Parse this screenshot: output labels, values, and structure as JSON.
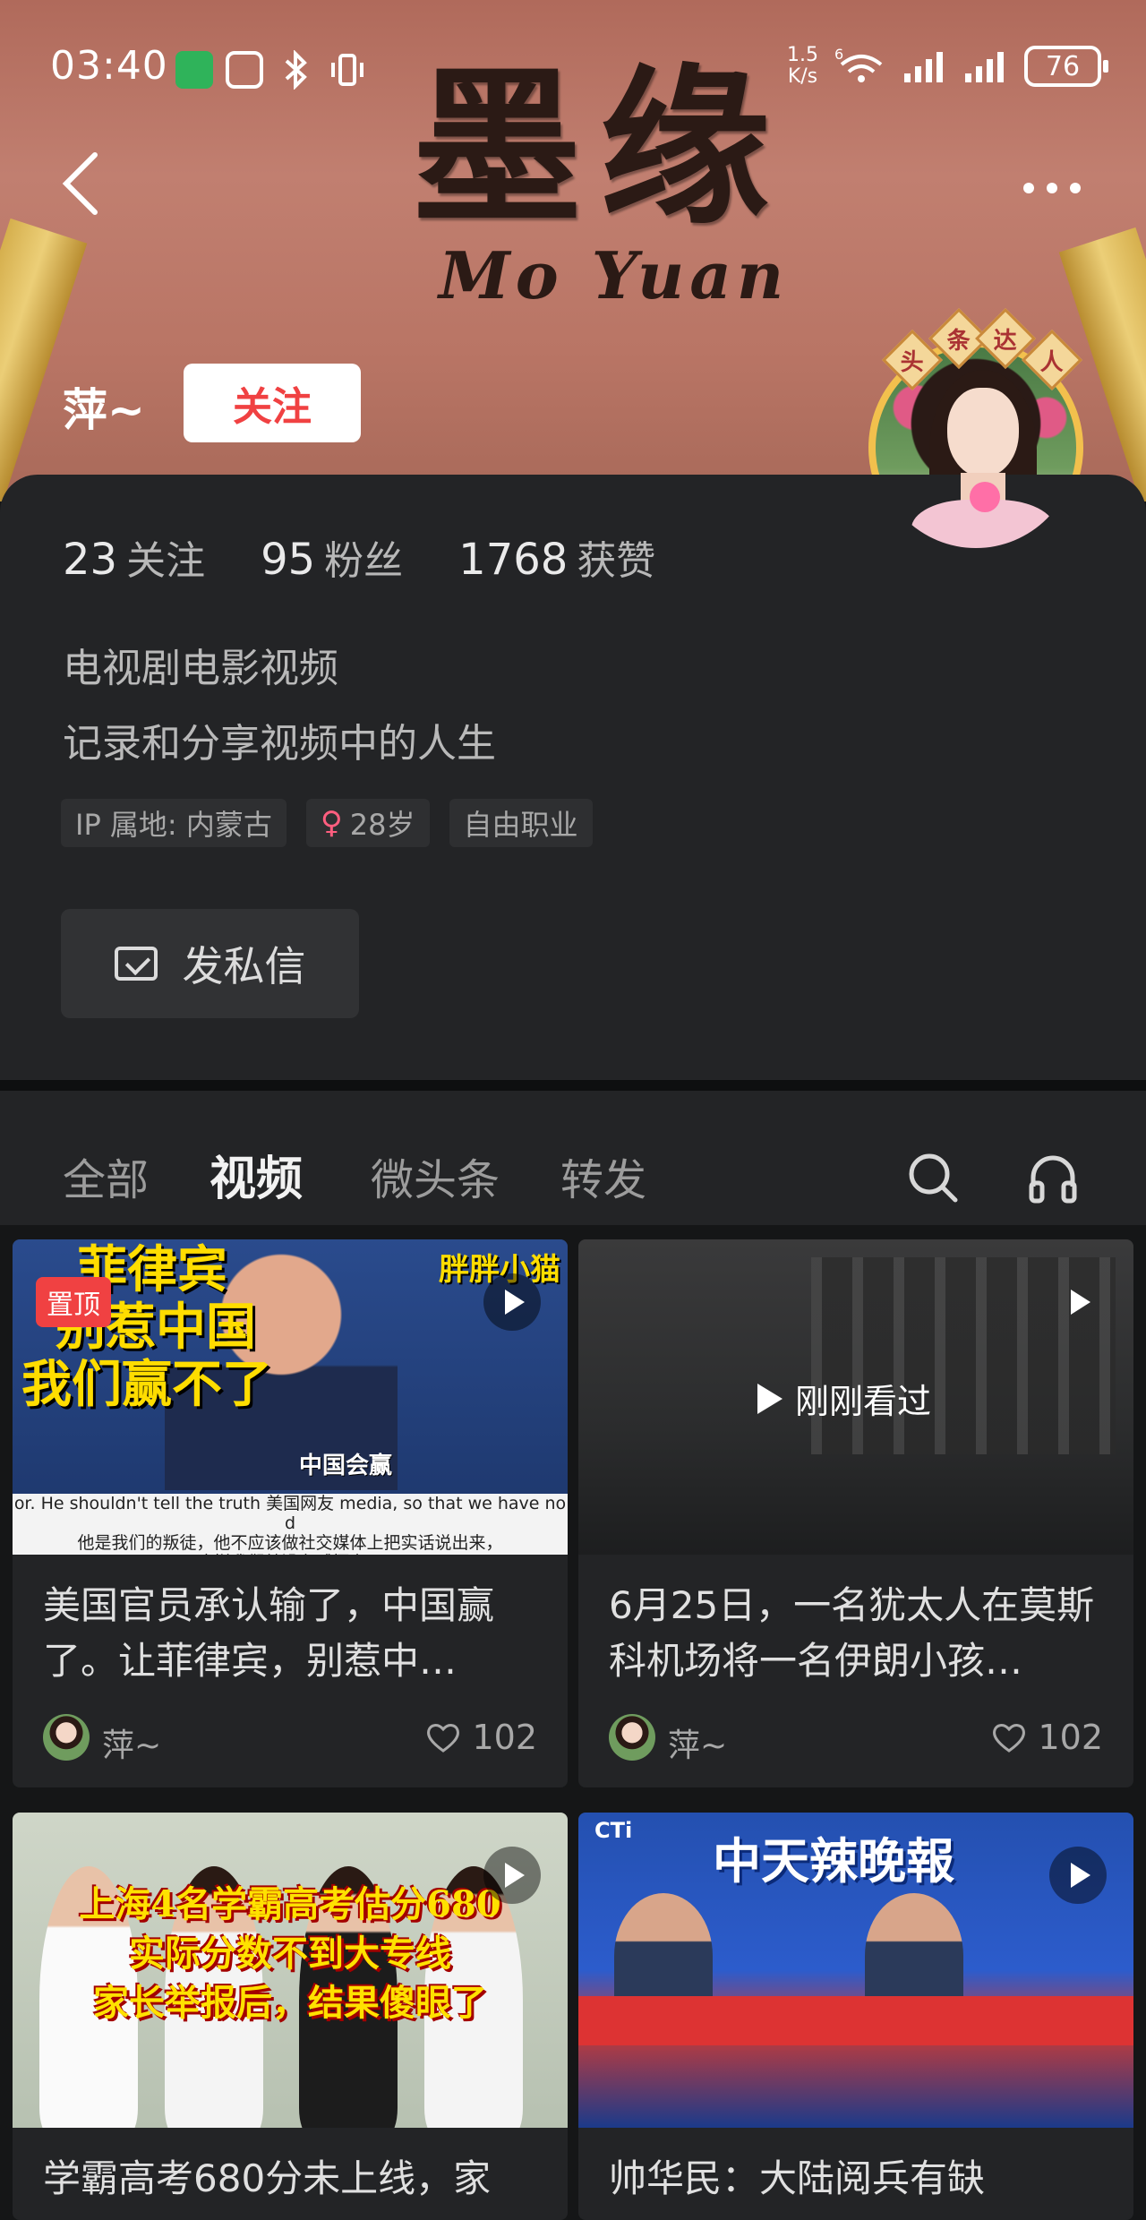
{
  "status_bar": {
    "time": "03:40",
    "net_speed": "1.5\nK/s",
    "network_tag": "6",
    "battery": "76"
  },
  "banner": {
    "calligraphy_cn": "墨缘",
    "calligraphy_en": "Mo Yuan",
    "badge_chars": [
      "头",
      "条",
      "达",
      "人"
    ]
  },
  "profile": {
    "name": "萍~",
    "follow_label": "关注",
    "stats": [
      {
        "num": "23",
        "label": "关注"
      },
      {
        "num": "95",
        "label": "粉丝"
      },
      {
        "num": "1768",
        "label": "获赞"
      }
    ],
    "bio_line1": "电视剧电影视频",
    "bio_line2": "记录和分享视频中的人生",
    "tags": {
      "ip": "IP 属地: 内蒙古",
      "female_symbol": "♀",
      "age": "28岁",
      "job": "自由职业"
    },
    "dm_label": "发私信"
  },
  "tabs": [
    "全部",
    "视频",
    "微头条",
    "转发"
  ],
  "active_tab": "视频",
  "cards": [
    {
      "title": "美国官员承认输了，中国赢了。让菲律宾，别惹中…",
      "author": "萍~",
      "likes": "102",
      "pinned_label": "置顶",
      "thumb_lines": [
        "菲律宾",
        "别惹中国",
        "我们赢不了"
      ],
      "thumb_corner": "胖胖小猫",
      "thumb_caption": "中国会赢",
      "thumb_sub": "or. He shouldn't tell the truth 美国网友 media, so that we have no d\n他是我们的叛徒，他不应该做社交媒体上把实话说出来，\n这样我们就没有威慑力了"
    },
    {
      "title": "6月25日，一名犹太人在莫斯科机场将一名伊朗小孩…",
      "author": "萍~",
      "likes": "102",
      "watched_label": "刚刚看过"
    },
    {
      "title": "学霸高考680分未上线，家",
      "thumb_lines": [
        "上海4名学霸高考估分680",
        "实际分数不到大专线",
        "家长举报后，结果傻眼了"
      ]
    },
    {
      "title": "帅华民：大陆阅兵有缺",
      "thumb_title": "中天辣晚報",
      "thumb_logo": "CTi"
    }
  ],
  "colors": {
    "accent_red": "#f04142",
    "panel_bg": "#232426",
    "page_bg": "#151617"
  },
  "icons": [
    "back-icon",
    "more-icon",
    "mail-icon",
    "search-icon",
    "headphone-icon",
    "heart-icon",
    "play-icon"
  ]
}
